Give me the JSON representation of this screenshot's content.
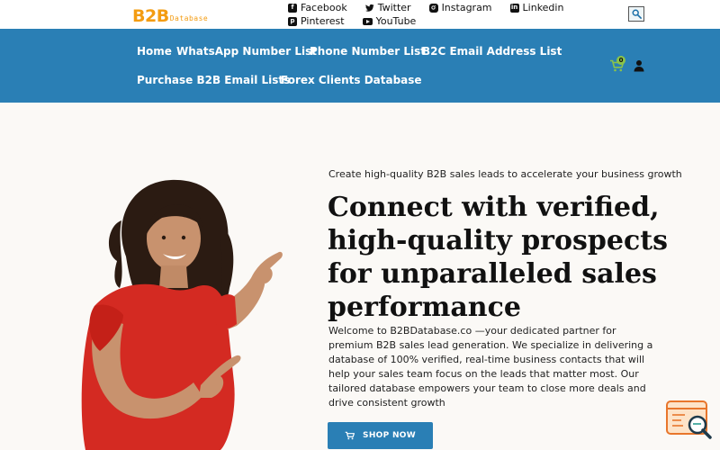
{
  "logo": {
    "main": "B2B",
    "sub": "Database"
  },
  "social": [
    {
      "label": "Facebook",
      "icon": "facebook-icon"
    },
    {
      "label": "Twitter",
      "icon": "twitter-icon"
    },
    {
      "label": "Instagram",
      "icon": "instagram-icon"
    },
    {
      "label": "Linkedin",
      "icon": "linkedin-icon"
    },
    {
      "label": "Pinterest",
      "icon": "pinterest-icon"
    },
    {
      "label": "YouTube",
      "icon": "youtube-icon"
    }
  ],
  "nav": {
    "items": [
      "Home",
      "WhatsApp Number List",
      "Phone Number List",
      "B2C Email Address List",
      "Purchase B2B Email Lists",
      "Forex Clients Database"
    ],
    "cart_count": "0"
  },
  "hero": {
    "tagline": "Create high-quality B2B sales leads to accelerate your business growth",
    "headline": "Connect with verified, high-quality prospects for unparalleled sales performance",
    "description": "Welcome to B2BDatabase.co —your dedicated partner for premium B2B sales lead generation. We specialize in delivering a database of 100% verified, real-time business contacts that will help your sales team focus on the leads that matter most. Our tailored database empowers your team to close more deals and drive consistent growth",
    "button": "SHOP NOW"
  },
  "colors": {
    "nav_bg": "#2a7fb5",
    "logo_orange": "#f39c12",
    "page_bg": "#fbf9f6",
    "cart_badge": "#8bc34a"
  }
}
